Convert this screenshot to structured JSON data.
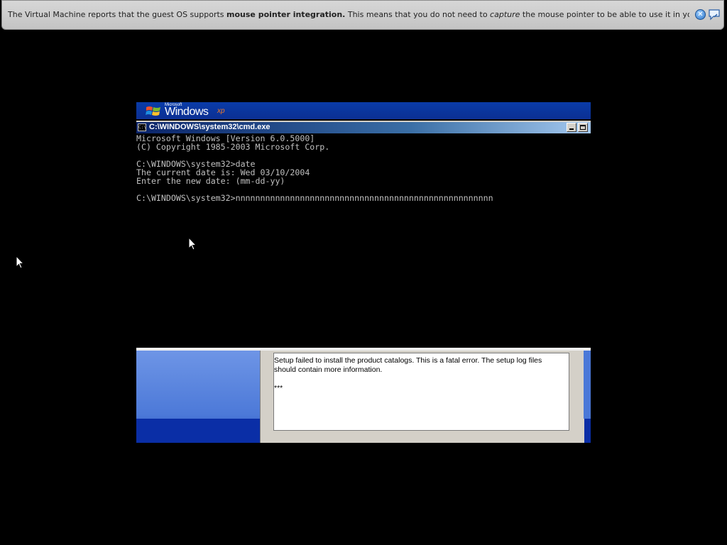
{
  "notification": {
    "text_1": "The Virtual Machine reports that the guest OS supports ",
    "text_bold": "mouse pointer integration.",
    "text_2": " This means that you do not need to ",
    "text_italic": "capture",
    "text_3": " the mouse pointer to be able to use it in your guest OS -- all mouse",
    "close_icon": "close-icon",
    "info_icon": "info-bubble-icon"
  },
  "guest": {
    "banner": {
      "microsoft_label": "Microsoft",
      "windows_label": "Windows",
      "xp_label": "xp"
    },
    "cmd": {
      "icon_label": "C:\\",
      "title": "C:\\WINDOWS\\system32\\cmd.exe",
      "lines": [
        "Microsoft Windows [Version 6.0.5000]",
        "(C) Copyright 1985-2003 Microsoft Corp.",
        "",
        "C:\\WINDOWS\\system32>date",
        "The current date is: Wed 03/10/2004",
        "Enter the new date: (mm-dd-yy)",
        "",
        "C:\\WINDOWS\\system32>nnnnnnnnnnnnnnnnnnnnnnnnnnnnnnnnnnnnnnnnnnnnnnnnnnnn"
      ]
    },
    "setup_log": {
      "line_1": "Setup failed to install the product catalogs. This is a fatal error. The setup log files",
      "line_2": "should contain more information.",
      "line_3": "***"
    }
  }
}
